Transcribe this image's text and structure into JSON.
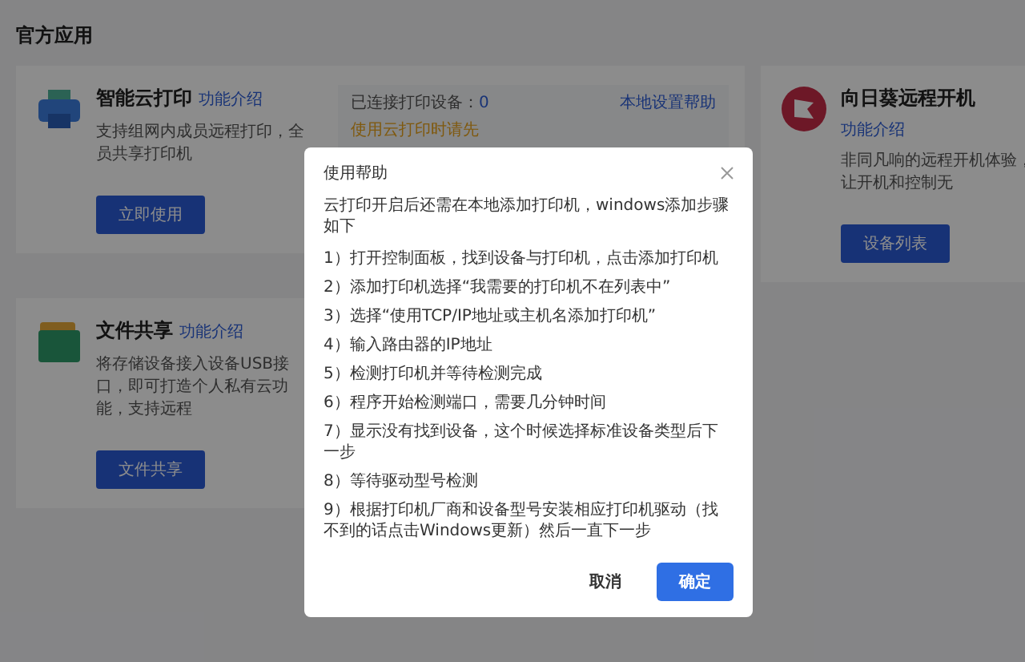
{
  "section_title": "官方应用",
  "apps": [
    {
      "kind": "print",
      "title": "智能云打印",
      "link": "功能介绍",
      "description": "支持组网内成员远程打印，全员共享打印机",
      "button": "立即使用",
      "status_label": "已连接打印设备：",
      "status_count": "0",
      "help_link": "本地设置帮助",
      "notice": "使用云打印时请先"
    },
    {
      "kind": "wake",
      "title": "向日葵远程开机",
      "link": "功能介绍",
      "description": "非同凡响的远程开机体验，让开机和控制无",
      "button": "设备列表"
    },
    {
      "kind": "share",
      "title": "文件共享",
      "link": "功能介绍",
      "description": "将存储设备接入设备USB接口，即可打造个人私有云功能，支持远程",
      "button": "文件共享"
    }
  ],
  "dialog": {
    "title": "使用帮助",
    "intro": "云打印开启后还需在本地添加打印机，windows添加步骤如下",
    "steps": [
      "1）打开控制面板，找到设备与打印机，点击添加打印机",
      "2）添加打印机选择“我需要的打印机不在列表中”",
      "3）选择“使用TCP/IP地址或主机名添加打印机”",
      "4）输入路由器的IP地址",
      "5）检测打印机并等待检测完成",
      "6）程序开始检测端口，需要几分钟时间",
      "7）显示没有找到设备，这个时候选择标准设备类型后下一步",
      "8）等待驱动型号检测",
      "9）根据打印机厂商和设备型号安装相应打印机驱动（找不到的话点击Windows更新）然后一直下一步"
    ],
    "buttons": [
      {
        "label": "取消",
        "kind": "secondary"
      },
      {
        "label": "确定",
        "kind": "primary"
      }
    ]
  }
}
